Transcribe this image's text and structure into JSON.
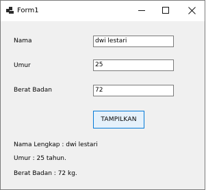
{
  "window": {
    "title": "Form1"
  },
  "form": {
    "nama": {
      "label": "Nama",
      "value": "dwi lestari"
    },
    "umur": {
      "label": "Umur",
      "value": "25"
    },
    "berat": {
      "label": "Berat Badan",
      "value": "72"
    }
  },
  "button": {
    "label": "TAMPILKAN"
  },
  "output": {
    "line1": "Nama Lengkap : dwi lestari",
    "line2": "Umur : 25 tahun.",
    "line3": "Berat Badan : 72 kg."
  },
  "icons": [
    "app-icon",
    "minimize-icon",
    "maximize-icon",
    "close-icon"
  ]
}
